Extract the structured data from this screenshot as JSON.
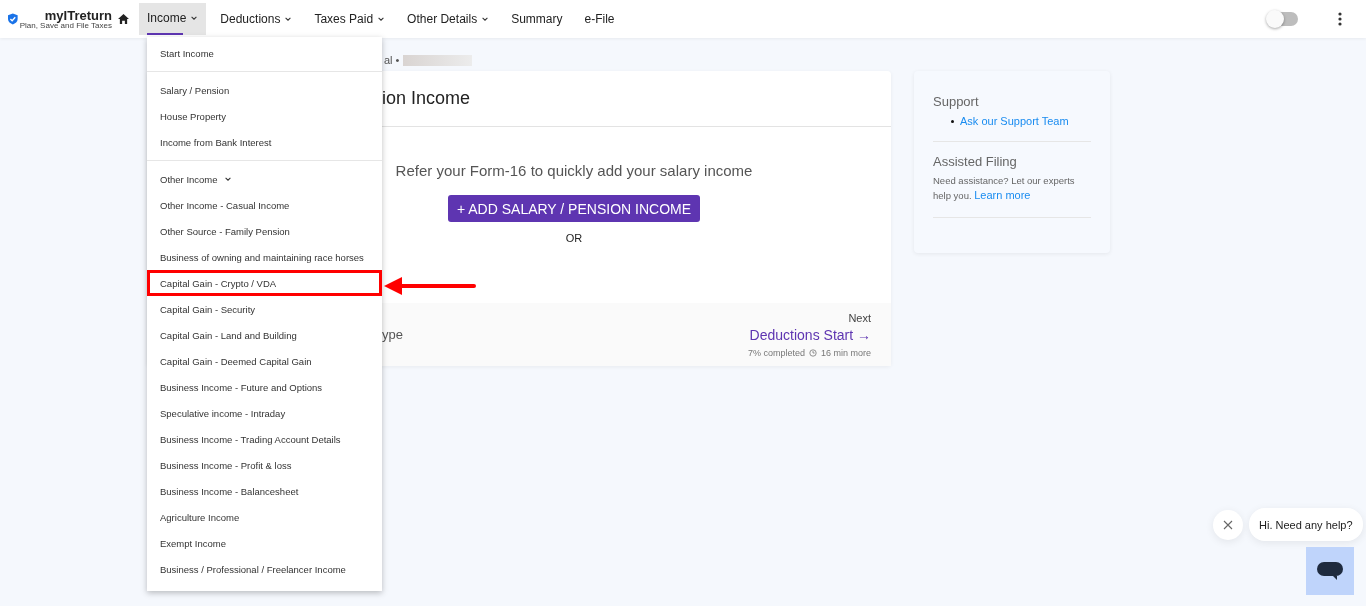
{
  "logo": {
    "name": "myITreturn",
    "tagline": "Plan, Save and File Taxes"
  },
  "nav": [
    {
      "label": "Income",
      "dropdown": true,
      "selected": true
    },
    {
      "label": "Deductions",
      "dropdown": true,
      "selected": false
    },
    {
      "label": "Taxes Paid",
      "dropdown": true,
      "selected": false
    },
    {
      "label": "Other Details",
      "dropdown": true,
      "selected": false
    },
    {
      "label": "Summary",
      "dropdown": false,
      "selected": false
    },
    {
      "label": "e-File",
      "dropdown": false,
      "selected": false
    }
  ],
  "theme_toggle": {
    "on": false
  },
  "income_menu": {
    "sections": [
      {
        "items": [
          {
            "label": "Start Income",
            "highlighted": false
          }
        ]
      },
      {
        "items": [
          {
            "label": "Salary / Pension",
            "highlighted": false
          },
          {
            "label": "House Property",
            "highlighted": false
          },
          {
            "label": "Income from Bank Interest",
            "highlighted": false
          }
        ]
      },
      {
        "group": {
          "label": "Other Income",
          "expanded": true
        },
        "items": [
          {
            "label": "Other Income - Casual Income",
            "highlighted": false
          },
          {
            "label": "Other Source - Family Pension",
            "highlighted": false
          },
          {
            "label": "Business of owning and maintaining race horses",
            "highlighted": false
          },
          {
            "label": "Capital Gain - Crypto / VDA",
            "highlighted": true
          },
          {
            "label": "Capital Gain - Security",
            "highlighted": false
          },
          {
            "label": "Capital Gain - Land and Building",
            "highlighted": false
          },
          {
            "label": "Capital Gain - Deemed Capital Gain",
            "highlighted": false
          },
          {
            "label": "Business Income - Future and Options",
            "highlighted": false
          },
          {
            "label": "Speculative income - Intraday",
            "highlighted": false
          },
          {
            "label": "Business Income - Trading Account Details",
            "highlighted": false
          },
          {
            "label": "Business Income - Profit & loss",
            "highlighted": false
          },
          {
            "label": "Business Income - Balancesheet",
            "highlighted": false
          },
          {
            "label": "Agriculture Income",
            "highlighted": false
          },
          {
            "label": "Exempt Income",
            "highlighted": false
          },
          {
            "label": "Business / Professional / Freelancer Income",
            "highlighted": false
          }
        ]
      }
    ]
  },
  "breadcrumb": {
    "text": "al •"
  },
  "main_card": {
    "title": "ion Income",
    "prompt": "Refer your Form-16 to quickly add your salary income",
    "add_button": "+ ADD SALARY / PENSION INCOME",
    "separator": "OR",
    "footer": {
      "left": "ype",
      "next_label": "Next",
      "next_link": "Deductions Start →",
      "progress": "7% completed",
      "time_left": "16 min more"
    }
  },
  "sidebar": {
    "support_title": "Support",
    "support_links": [
      "Ask our Support Team"
    ],
    "assisted_title": "Assisted Filing",
    "assisted_text": "Need assistance? Let our experts help you.",
    "assisted_link": "Learn more"
  },
  "chat": {
    "greeting": "Hi. Need any help?"
  }
}
